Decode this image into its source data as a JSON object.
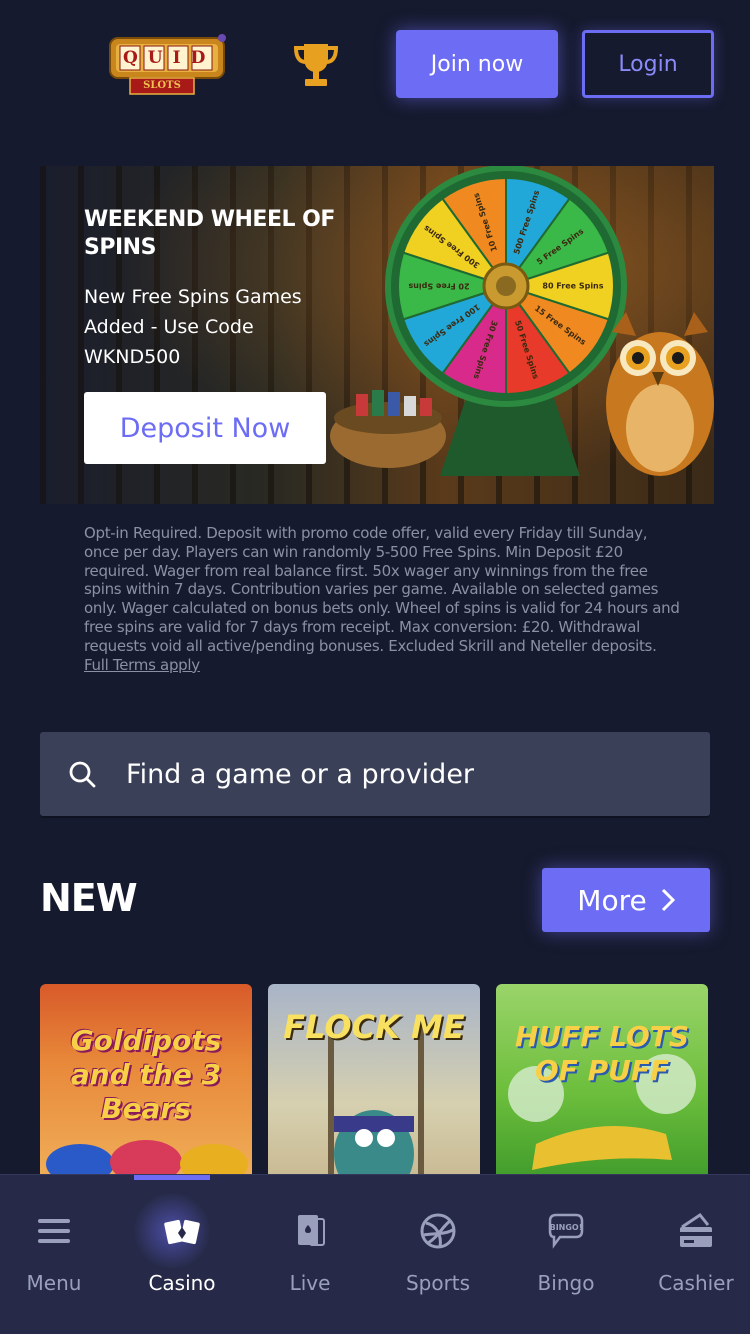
{
  "header": {
    "logo_text_top": "QUID",
    "logo_text_bottom": "SLOTS",
    "trophy_icon": "trophy-icon",
    "join_label": "Join now",
    "login_label": "Login"
  },
  "promo": {
    "title": "WEEKEND WHEEL OF SPINS",
    "subtitle": "New Free Spins Games Added - Use Code WKND500",
    "cta_label": "Deposit Now",
    "wheel_segments": [
      "500 Free Spins",
      "5 Free Spins",
      "80 Free Spins",
      "15 Free Spins",
      "50 Free Spins",
      "30 Free Spins",
      "100 Free Spins",
      "20 Free Spins",
      "300 Free Spins",
      "10 Free Spins"
    ]
  },
  "terms": {
    "text": "Opt-in Required. Deposit with promo code offer, valid every Friday till Sunday, once per day. Players can win randomly 5-500 Free Spins. Min Deposit £20 required. Wager from real balance first. 50x wager any winnings from the free spins within 7 days. Contribution varies per game. Available on selected games only. Wager calculated on bonus bets only. Wheel of spins is valid for 24 hours and free spins are valid for 7 days from receipt. Max conversion: £20. Withdrawal requests void all active/pending bonuses. Excluded Skrill and Neteller deposits.",
    "link_label": "Full Terms apply"
  },
  "search": {
    "placeholder": "Find a game or a provider"
  },
  "new_section": {
    "title": "NEW",
    "more_label": "More",
    "games": [
      {
        "title": "Goldipots and the 3 Bears"
      },
      {
        "title": "FLOCK ME"
      },
      {
        "title": "HUFF LOTS OF PUFF"
      }
    ]
  },
  "bottom_nav": {
    "items": [
      {
        "label": "Menu",
        "icon": "menu-icon"
      },
      {
        "label": "Casino",
        "icon": "casino-icon"
      },
      {
        "label": "Live",
        "icon": "live-cards-icon"
      },
      {
        "label": "Sports",
        "icon": "sports-ball-icon"
      },
      {
        "label": "Bingo",
        "icon": "bingo-icon"
      },
      {
        "label": "Cashier",
        "icon": "cashier-icon"
      }
    ],
    "active": "Casino"
  },
  "colors": {
    "background": "#161a2e",
    "accent": "#6c6cf4",
    "nav_background": "#262a48",
    "search_background": "#3a4058"
  }
}
